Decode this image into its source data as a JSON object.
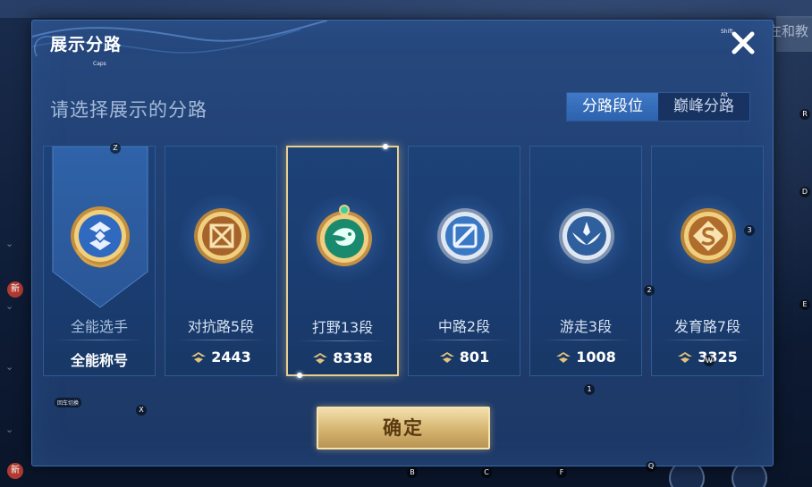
{
  "background": {
    "right_text": "在和教",
    "new_badge": "新"
  },
  "dialog": {
    "title": "展示分路",
    "close_label": "✕",
    "subtitle": "请选择展示的分路",
    "toggle": [
      {
        "label": "分路段位",
        "active": true
      },
      {
        "label": "巅峰分路",
        "active": false
      }
    ],
    "cards": [
      {
        "label": "全能选手",
        "bottom": "全能称号",
        "emblem": "all-round-emblem-icon",
        "selected": false,
        "ribbon": true
      },
      {
        "label": "对抗路5段",
        "score": "2443",
        "emblem": "clash-lane-emblem-icon",
        "selected": false
      },
      {
        "label": "打野13段",
        "score": "8338",
        "emblem": "jungle-dragon-emblem-icon",
        "selected": true
      },
      {
        "label": "中路2段",
        "score": "801",
        "emblem": "mid-lane-emblem-icon",
        "selected": false
      },
      {
        "label": "游走3段",
        "score": "1008",
        "emblem": "roam-emblem-icon",
        "selected": false
      },
      {
        "label": "发育路7段",
        "score": "3325",
        "emblem": "farm-lane-emblem-icon",
        "selected": false
      }
    ],
    "confirm_label": "确定"
  },
  "key_hints": {
    "shift": "Shift",
    "caps": "Caps",
    "alt": "Alt",
    "z": "Z",
    "x": "X",
    "r": "R",
    "d": "D",
    "e": "E",
    "num3": "3",
    "num2": "2",
    "num1": "1",
    "b": "B",
    "c": "C",
    "f": "F",
    "q": "Q",
    "w": "W",
    "back": "回车切换"
  },
  "colors": {
    "dialog_bg": "#22447a",
    "selected_border": "#e8cf8f",
    "confirm_gold": "#d8b873",
    "toggle_active": "#3670bf"
  }
}
